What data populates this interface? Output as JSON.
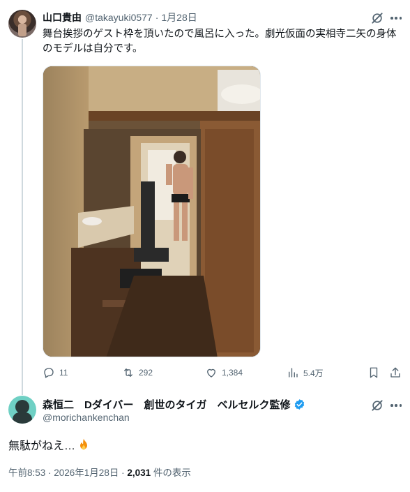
{
  "tweet": {
    "author_name": "山口貴由",
    "author_handle": "@takayuki0577",
    "separator": "·",
    "date": "1月28日",
    "text": "舞台挨拶のゲスト枠を頂いたので風呂に入った。劇光仮面の実相寺二矢の身体のモデルは自分です。",
    "metrics": {
      "replies": "11",
      "reposts": "292",
      "likes": "1,384",
      "views": "5.4万"
    }
  },
  "reply": {
    "author_name": "森恒二　Dダイバー　創世のタイガ　ベルセルク監修",
    "author_handle": "@morichankenchan",
    "text": "無駄がねえ…",
    "timestamp": "午前8:53 · 2026年1月28日 · ",
    "view_count": "2,031",
    "view_suffix": " 件の表示"
  },
  "colors": {
    "text": "#0f1419",
    "secondary": "#536471",
    "verified": "#1d9bf0",
    "thread_line": "#cfd9de"
  },
  "icons": [
    "grok-icon",
    "more-icon",
    "reply-icon",
    "repost-icon",
    "like-icon",
    "views-icon",
    "bookmark-icon",
    "share-icon",
    "verified-icon",
    "fire-icon"
  ]
}
